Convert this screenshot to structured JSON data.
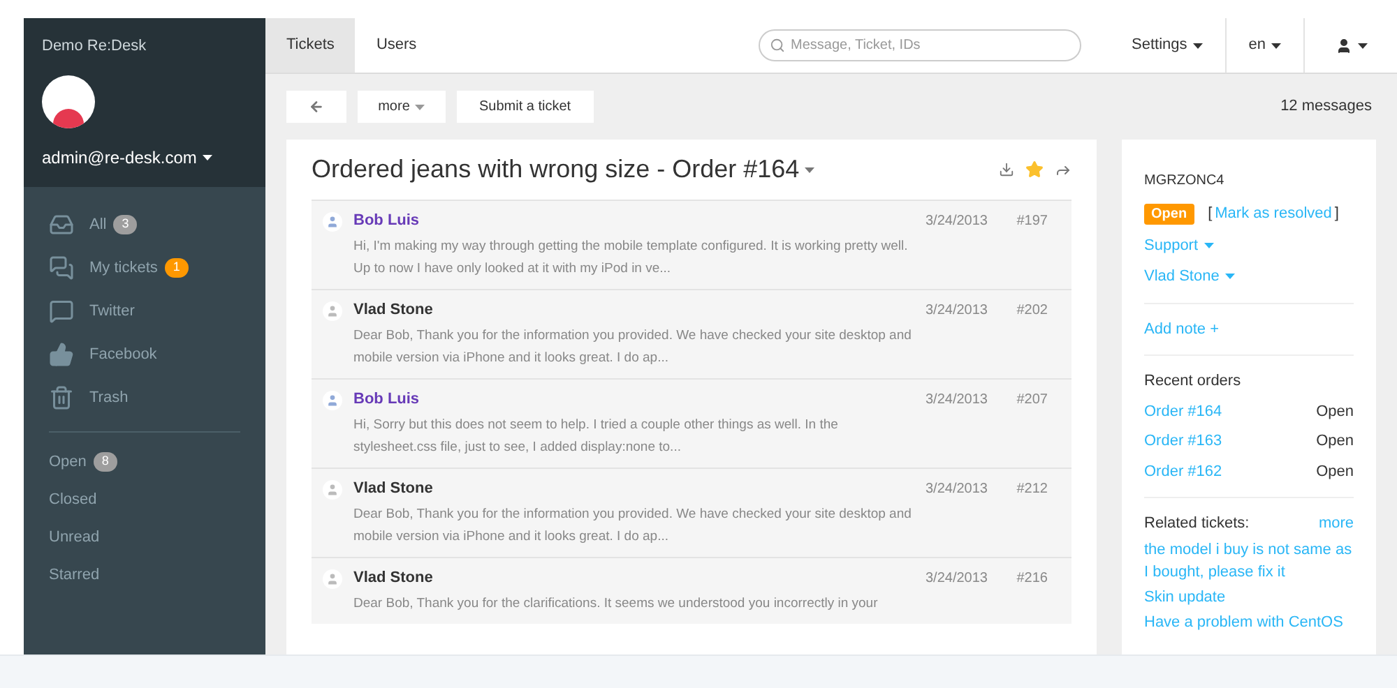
{
  "sidebar": {
    "brand": "Demo Re:Desk",
    "user": "admin@re-desk.com",
    "folders": [
      {
        "kind": "inbox",
        "label": "All",
        "badge": "3",
        "color": "#9e9e9e",
        "selected": false
      },
      {
        "kind": "chat",
        "label": "My tickets",
        "badge": "1",
        "color": "#ff9800",
        "selected": false
      },
      {
        "kind": "message",
        "label": "Twitter",
        "selected": false
      },
      {
        "kind": "like",
        "label": "Facebook",
        "selected": false
      },
      {
        "kind": "trash",
        "label": "Trash",
        "selected": false
      }
    ],
    "filters": [
      {
        "label": "Open",
        "badge": "8",
        "selected": false
      },
      {
        "label": "Closed",
        "selected": false
      },
      {
        "label": "Unread",
        "selected": false
      },
      {
        "label": "Starred",
        "selected": false
      }
    ]
  },
  "nav": {
    "tabs": [
      {
        "label": "Tickets",
        "selected": true
      },
      {
        "label": "Users",
        "selected": false
      }
    ],
    "search": {
      "placeholder": "Message, Ticket, IDs"
    },
    "menus": [
      {
        "kind": "text",
        "label": "Settings"
      },
      {
        "kind": "text",
        "label": "en"
      },
      {
        "kind": "user"
      }
    ]
  },
  "toolbar": {
    "buttons": [
      {
        "kind": "back"
      },
      {
        "kind": "menu",
        "label": "more"
      },
      {
        "kind": "text",
        "label": "Submit a ticket"
      }
    ],
    "count": "12 messages"
  },
  "ticket": {
    "title": "Ordered jeans with wrong size - Order #164",
    "starred": true,
    "messages": [
      {
        "author": "Bob Luis",
        "customer": true,
        "date": "3/24/2013",
        "id": "#197",
        "body": "Hi, I'm making my way through getting the mobile template configured. It is working pretty well. Up to now I have only looked at it with my iPod in ve..."
      },
      {
        "author": "Vlad Stone",
        "customer": false,
        "date": "3/24/2013",
        "id": "#202",
        "body": "Dear Bob, Thank you for the information you provided. We have checked your site desktop and mobile version via iPhone and it looks great. I do ap..."
      },
      {
        "author": "Bob Luis",
        "customer": true,
        "date": "3/24/2013",
        "id": "#207",
        "body": "Hi, Sorry but this does not seem to help. I tried a couple other things as well. In the stylesheet.css file, just to see, I added display:none to..."
      },
      {
        "author": "Vlad Stone",
        "customer": false,
        "date": "3/24/2013",
        "id": "#212",
        "body": "Dear Bob, Thank you for the information you provided. We have checked your site desktop and mobile version via iPhone and it looks great. I do ap..."
      },
      {
        "author": "Vlad Stone",
        "customer": false,
        "date": "3/24/2013",
        "id": "#216",
        "body": "Dear Bob, Thank you for the clarifications. It seems we understood you incorrectly in your"
      }
    ]
  },
  "details": {
    "code": "MGRZONC4",
    "status": "Open",
    "resolve_open": "[",
    "resolve": "Mark as resolved",
    "resolve_close": "]",
    "dropdowns": [
      "Support",
      "Vlad Stone"
    ],
    "add_note": "Add note +",
    "orders_title": "Recent orders",
    "orders": [
      {
        "name": "Order #164",
        "status": "Open"
      },
      {
        "name": "Order #163",
        "status": "Open"
      },
      {
        "name": "Order #162",
        "status": "Open"
      }
    ],
    "related_title": "Related tickets:",
    "related_more": "more",
    "related": [
      "the model i buy is not same as I bought, please fix it",
      "Skin update",
      "Have a problem with CentOS"
    ]
  }
}
